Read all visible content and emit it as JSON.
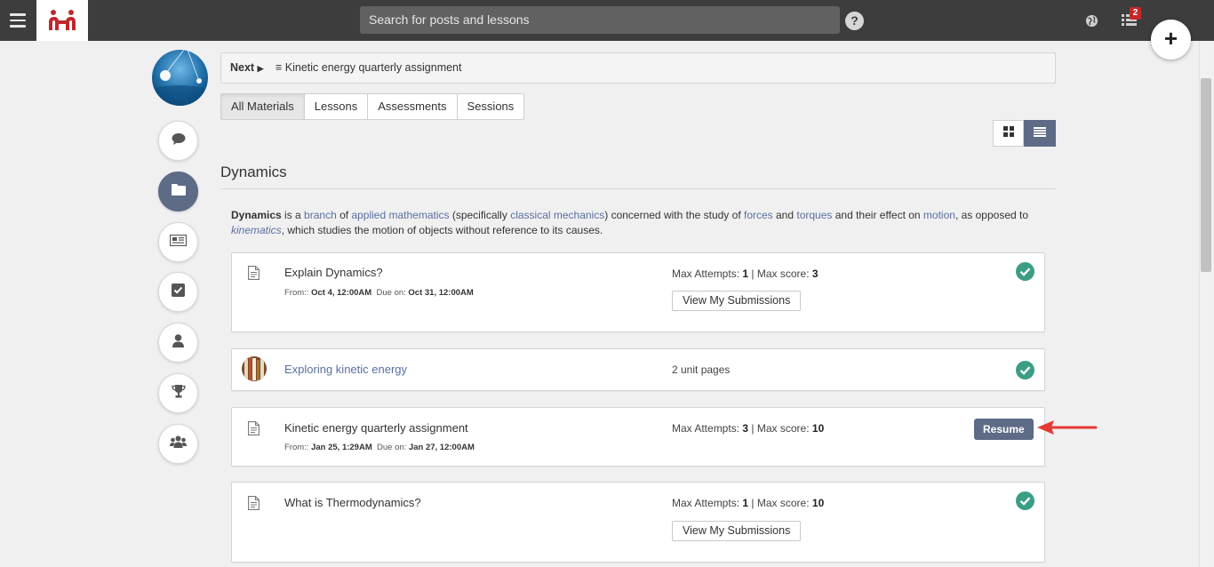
{
  "topbar": {
    "search_placeholder": "Search for posts and lessons",
    "notification_count": "2",
    "fab_label": "+"
  },
  "nextbar": {
    "next_label": "Next",
    "next_item": "Kinetic energy quarterly assignment"
  },
  "tabs": [
    {
      "label": "All Materials",
      "active": true
    },
    {
      "label": "Lessons",
      "active": false
    },
    {
      "label": "Assessments",
      "active": false
    },
    {
      "label": "Sessions",
      "active": false
    }
  ],
  "section": {
    "title": "Dynamics",
    "description": {
      "term": "Dynamics",
      "t1": " is a ",
      "l1": "branch",
      "t2": " of ",
      "l2": "applied mathematics",
      "t3": " (specifically ",
      "l3": "classical mechanics",
      "t4": ") concerned with the study of ",
      "l4": "forces",
      "t5": " and ",
      "l5": "torques",
      "t6": " and their effect on ",
      "l6": "motion",
      "t7": ", as opposed to ",
      "l7": "kinematics",
      "t8": ", which studies the motion of objects without reference to its causes."
    }
  },
  "items": [
    {
      "title": "Explain Dynamics?",
      "from_label": "From::",
      "from": "Oct 4, 12:00AM",
      "due_label": "Due on:",
      "due": "Oct 31, 12:00AM",
      "attempts_label": "Max Attempts:",
      "attempts": "1",
      "separator": "|",
      "score_label": "Max score:",
      "score": "3",
      "button": "View My Submissions",
      "completed": true
    },
    {
      "title": "Exploring kinetic energy",
      "unit_pages": "2 unit pages",
      "completed": true
    },
    {
      "title": "Kinetic energy quarterly assignment",
      "from_label": "From::",
      "from": "Jan 25, 1:29AM",
      "due_label": "Due on:",
      "due": "Jan 27, 12:00AM",
      "attempts_label": "Max Attempts:",
      "attempts": "3",
      "separator": "|",
      "score_label": "Max score:",
      "score": "10",
      "button": "Resume",
      "completed": false
    },
    {
      "title": "What is Thermodynamics?",
      "attempts_label": "Max Attempts:",
      "attempts": "1",
      "separator": "|",
      "score_label": "Max score:",
      "score": "10",
      "button": "View My Submissions",
      "completed": true
    }
  ],
  "colors": {
    "topbar": "#3d3d3d",
    "accent": "#5d6b86",
    "link": "#5a6fa0",
    "success": "#3a9e84",
    "brand": "#c0272d",
    "annotation_arrow": "#e53935"
  },
  "icons": {
    "sidebar": [
      "chat-icon",
      "folder-icon",
      "newspaper-icon",
      "checkbox-icon",
      "user-icon",
      "trophy-icon",
      "users-icon"
    ],
    "topbar": [
      "menu-icon",
      "help-icon",
      "globe-icon",
      "list-icon",
      "plus-icon"
    ]
  }
}
